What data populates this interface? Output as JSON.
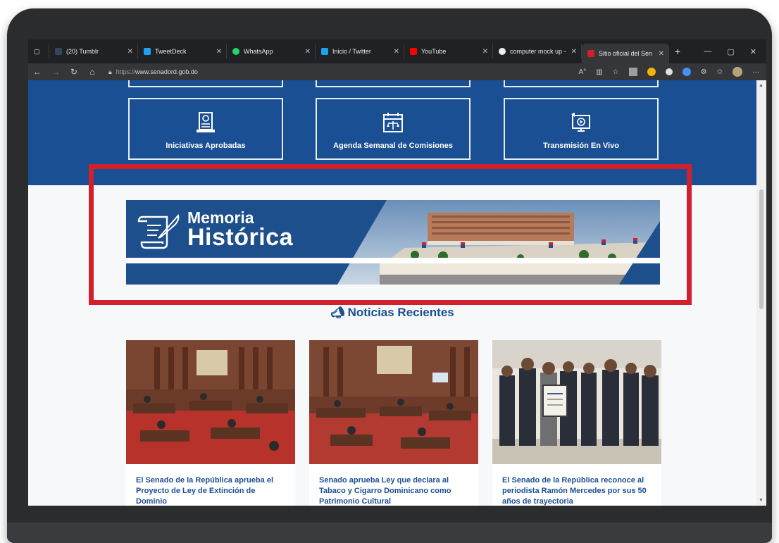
{
  "browser": {
    "tabs": [
      {
        "label": "(20) Tumblr",
        "favicon_color": "#35465c",
        "icon": "tumblr-icon"
      },
      {
        "label": "TweetDeck",
        "favicon_color": "#1da1f2",
        "icon": "tweetdeck-icon"
      },
      {
        "label": "WhatsApp",
        "favicon_color": "#25d366",
        "icon": "whatsapp-icon"
      },
      {
        "label": "Inicio / Twitter",
        "favicon_color": "#1da1f2",
        "icon": "twitter-icon"
      },
      {
        "label": "YouTube",
        "favicon_color": "#ff0000",
        "icon": "youtube-icon"
      },
      {
        "label": "computer mock up -",
        "favicon_color": "#eeeeee",
        "icon": "google-icon"
      },
      {
        "label": "Sitio oficial del Sen",
        "favicon_color": "#d0202b",
        "icon": "senado-icon",
        "active": true
      }
    ],
    "new_tab": "+",
    "url_scheme": "https://",
    "url_host": "www.senadord.gob.do"
  },
  "tiles": [
    {
      "label": "Iniciativas Aprobadas",
      "icon": "document-approved-icon"
    },
    {
      "label": "Agenda Semanal de Comisiones",
      "icon": "calendar-scale-icon"
    },
    {
      "label": "Transmisión En Vivo",
      "icon": "live-broadcast-icon"
    }
  ],
  "banner": {
    "title_line1": "Memoria",
    "title_line2": "Histórica",
    "icon": "scroll-quill-icon"
  },
  "news": {
    "heading": "Noticias Recientes",
    "icon": "megaphone-icon",
    "items": [
      {
        "title": "El Senado de la República aprueba el Proyecto de Ley de Extinción de Dominio"
      },
      {
        "title": "Senado aprueba Ley que declara al Tabaco y Cigarro Dominicano como Patrimonio Cultural"
      },
      {
        "title": "El Senado de la República reconoce al periodista Ramón Mercedes por sus 50 años de trayectoria"
      }
    ]
  },
  "colors": {
    "brand_blue": "#1b4f93",
    "highlight_red": "#d0202b"
  }
}
